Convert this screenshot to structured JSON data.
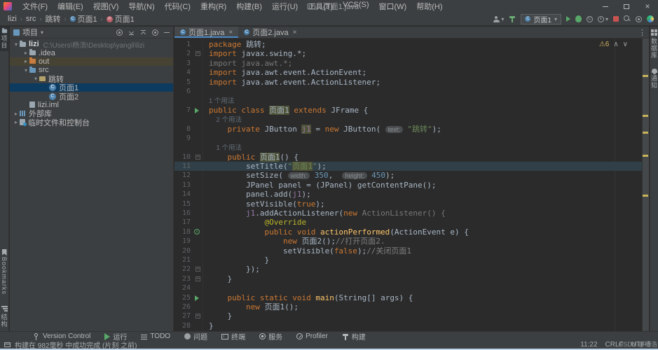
{
  "window": {
    "title": "lizi - 页面1.java"
  },
  "menu": {
    "items": [
      "文件(F)",
      "编辑(E)",
      "视图(V)",
      "导航(N)",
      "代码(C)",
      "重构(R)",
      "构建(B)",
      "运行(U)",
      "工具(T)",
      "VCS(S)",
      "窗口(W)",
      "帮助(H)"
    ]
  },
  "breadcrumb": {
    "items": [
      {
        "label": "lizi",
        "icon": ""
      },
      {
        "label": "src",
        "icon": ""
      },
      {
        "label": "跳转",
        "icon": ""
      },
      {
        "label": "页面1",
        "icon": "class"
      },
      {
        "label": "页面1",
        "icon": "method"
      }
    ]
  },
  "toolbar": {
    "run_config": "页面1"
  },
  "left_stripe": {
    "project": "项目",
    "bookmarks": "Bookmarks",
    "structure": "结构"
  },
  "right_stripe": {
    "database": "数据库",
    "notifications": "通知"
  },
  "project_panel": {
    "title": "项目",
    "tree": [
      {
        "level": 0,
        "chev": "▾",
        "icon": "folder",
        "label": "lizi",
        "bold": true,
        "sub": "C:\\Users\\杨浩\\Desktop\\yangli\\lizi"
      },
      {
        "level": 1,
        "chev": "▸",
        "icon": "folder",
        "label": ".idea"
      },
      {
        "level": 1,
        "chev": "▸",
        "icon": "folder-ex",
        "label": "out",
        "excluded": true
      },
      {
        "level": 1,
        "chev": "▾",
        "icon": "folder-blue",
        "label": "src"
      },
      {
        "level": 2,
        "chev": "▾",
        "icon": "package",
        "label": "跳转"
      },
      {
        "level": 3,
        "chev": "",
        "icon": "class",
        "label": "页面1",
        "selected": true
      },
      {
        "level": 3,
        "chev": "",
        "icon": "class",
        "label": "页面2"
      },
      {
        "level": 1,
        "chev": "",
        "icon": "iml",
        "label": "lizi.iml"
      },
      {
        "level": 0,
        "chev": "▸",
        "icon": "lib",
        "label": "外部库"
      },
      {
        "level": 0,
        "chev": "▸",
        "icon": "scratch",
        "label": "临时文件和控制台"
      }
    ]
  },
  "editor": {
    "tabs": [
      {
        "label": "页面1.java",
        "active": true
      },
      {
        "label": "页面2.java",
        "active": false
      }
    ],
    "inspection": {
      "warning_count": "6"
    },
    "rows": [
      {
        "n": "1",
        "seg": [
          [
            "k",
            "package "
          ],
          [
            "d",
            "跳转;"
          ]
        ]
      },
      {
        "n": "2",
        "f": "-",
        "seg": [
          [
            "k",
            "import "
          ],
          [
            "d",
            "javax.swing.*;"
          ]
        ]
      },
      {
        "n": "3",
        "seg": [
          [
            "g",
            "import java.awt.*;"
          ]
        ]
      },
      {
        "n": "4",
        "seg": [
          [
            "k",
            "import "
          ],
          [
            "d",
            "java.awt.event.ActionEvent;"
          ]
        ]
      },
      {
        "n": "5",
        "seg": [
          [
            "k",
            "import "
          ],
          [
            "d",
            "java.awt.event.ActionListener;"
          ]
        ]
      },
      {
        "n": "6",
        "seg": []
      },
      {
        "inlay": "1 个用法",
        "pad": ""
      },
      {
        "n": "7",
        "g": "run",
        "seg": [
          [
            "k",
            "public class "
          ],
          [
            "d hl",
            "页面1"
          ],
          [
            "k",
            " extends "
          ],
          [
            "d",
            "JFrame {"
          ]
        ]
      },
      {
        "inlay": "2 个用法",
        "pad": "    "
      },
      {
        "n": "8",
        "seg": [
          [
            "d",
            "    "
          ],
          [
            "k",
            "private "
          ],
          [
            "d",
            "JButton "
          ],
          [
            "v hl",
            "j1"
          ],
          [
            "d",
            " = "
          ],
          [
            "k",
            "new "
          ],
          [
            "d",
            "JButton( "
          ],
          [
            "hint",
            "text:"
          ],
          [
            "s",
            " \"跳转\""
          ],
          [
            "d",
            ");"
          ]
        ]
      },
      {
        "n": "9",
        "seg": []
      },
      {
        "inlay": "1 个用法",
        "pad": "    "
      },
      {
        "n": "10",
        "f": "-",
        "seg": [
          [
            "d",
            "    "
          ],
          [
            "k",
            "public "
          ],
          [
            "d hl",
            "页面1"
          ],
          [
            "d",
            "() {"
          ]
        ]
      },
      {
        "n": "11",
        "cur": true,
        "seg": [
          [
            "d",
            "        setTitle("
          ],
          [
            "s",
            "\""
          ],
          [
            "s hl",
            "页面1"
          ],
          [
            "s",
            "\""
          ],
          [
            "d",
            ");"
          ]
        ]
      },
      {
        "n": "12",
        "seg": [
          [
            "d",
            "        setSize( "
          ],
          [
            "hint",
            "width:"
          ],
          [
            "n",
            " 350"
          ],
          [
            "d",
            ",  "
          ],
          [
            "hint",
            "height:"
          ],
          [
            "n",
            " 450"
          ],
          [
            "d",
            ");"
          ]
        ]
      },
      {
        "n": "13",
        "seg": [
          [
            "d",
            "        JPanel panel = (JPanel) getContentPane();"
          ]
        ]
      },
      {
        "n": "14",
        "seg": [
          [
            "d",
            "        panel.add("
          ],
          [
            "v",
            "j1"
          ],
          [
            "d",
            ");"
          ]
        ]
      },
      {
        "n": "15",
        "seg": [
          [
            "d",
            "        setVisible("
          ],
          [
            "k",
            "true"
          ],
          [
            "d",
            ");"
          ]
        ]
      },
      {
        "n": "16",
        "seg": [
          [
            "d",
            "        "
          ],
          [
            "v",
            "j1"
          ],
          [
            "d",
            ".addActionListener("
          ],
          [
            "k",
            "new "
          ],
          [
            "g",
            "ActionListener() {"
          ]
        ]
      },
      {
        "n": "17",
        "seg": [
          [
            "d",
            "            "
          ],
          [
            "a",
            "@Override"
          ]
        ]
      },
      {
        "n": "18",
        "g": "override",
        "seg": [
          [
            "d",
            "            "
          ],
          [
            "k",
            "public void "
          ],
          [
            "m",
            "actionPerformed"
          ],
          [
            "d",
            "(ActionEvent e) {"
          ]
        ]
      },
      {
        "n": "19",
        "seg": [
          [
            "d",
            "                "
          ],
          [
            "k",
            "new "
          ],
          [
            "d",
            "页面2();"
          ],
          [
            "c",
            "//打开页面2."
          ]
        ]
      },
      {
        "n": "20",
        "seg": [
          [
            "d",
            "                setVisible("
          ],
          [
            "k",
            "false"
          ],
          [
            "d",
            ");"
          ],
          [
            "c",
            "//关闭页面1"
          ]
        ]
      },
      {
        "n": "21",
        "seg": [
          [
            "d",
            "            }"
          ]
        ]
      },
      {
        "n": "22",
        "f": "-",
        "seg": [
          [
            "d",
            "        });"
          ]
        ]
      },
      {
        "n": "23",
        "f": "-",
        "seg": [
          [
            "d",
            "    }"
          ]
        ]
      },
      {
        "n": "24",
        "seg": []
      },
      {
        "n": "25",
        "g": "run",
        "seg": [
          [
            "d",
            "    "
          ],
          [
            "k",
            "public static void "
          ],
          [
            "m",
            "main"
          ],
          [
            "d",
            "(String[] args) {"
          ]
        ]
      },
      {
        "n": "26",
        "seg": [
          [
            "d",
            "        "
          ],
          [
            "k",
            "new "
          ],
          [
            "d",
            "页面1();"
          ]
        ]
      },
      {
        "n": "27",
        "f": "-",
        "seg": [
          [
            "d",
            "    }"
          ]
        ]
      },
      {
        "n": "28",
        "seg": [
          [
            "d",
            "}"
          ]
        ]
      }
    ],
    "scroll_marks": [
      52,
      109,
      133,
      166,
      223
    ]
  },
  "tool_bar": {
    "buttons": [
      {
        "icon": "branch",
        "label": "Version Control"
      },
      {
        "icon": "play",
        "label": "运行"
      },
      {
        "icon": "todo",
        "label": "TODO"
      },
      {
        "icon": "problem",
        "label": "问题"
      },
      {
        "icon": "terminal",
        "label": "终端"
      },
      {
        "icon": "services",
        "label": "服务"
      },
      {
        "icon": "gauge",
        "label": "Profiler"
      },
      {
        "icon": "hammer2",
        "label": "构建"
      }
    ]
  },
  "status_bar": {
    "message": "构建在 982毫秒 中成功完成 (片刻 之前)",
    "time": "11:22",
    "line_ending": "CRLF",
    "encoding": "UTF-8"
  },
  "watermark": "CSDN @杨浩"
}
